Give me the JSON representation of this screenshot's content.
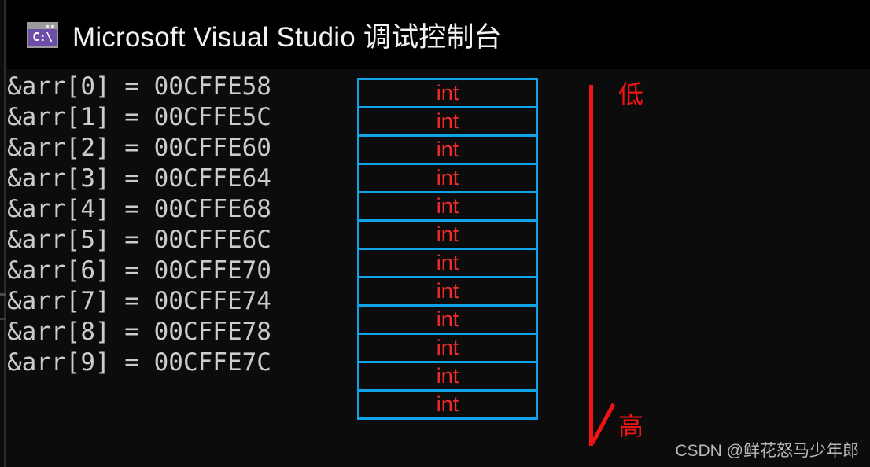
{
  "window": {
    "title": "Microsoft Visual Studio 调试控制台",
    "icon_name": "console-icon",
    "icon_text": "C:\\",
    "titlebar_bg": "#000000",
    "console_bg": "#0c0c0c"
  },
  "console": {
    "text_color": "#cccccc",
    "address_rows": [
      {
        "expr": "&arr[0]",
        "eq": "=",
        "address": "00CFFE58",
        "line": "&arr[0] = 00CFFE58"
      },
      {
        "expr": "&arr[1]",
        "eq": "=",
        "address": "00CFFE5C",
        "line": "&arr[1] = 00CFFE5C"
      },
      {
        "expr": "&arr[2]",
        "eq": "=",
        "address": "00CFFE60",
        "line": "&arr[2] = 00CFFE60"
      },
      {
        "expr": "&arr[3]",
        "eq": "=",
        "address": "00CFFE64",
        "line": "&arr[3] = 00CFFE64"
      },
      {
        "expr": "&arr[4]",
        "eq": "=",
        "address": "00CFFE68",
        "line": "&arr[4] = 00CFFE68"
      },
      {
        "expr": "&arr[5]",
        "eq": "=",
        "address": "00CFFE6C",
        "line": "&arr[5] = 00CFFE6C"
      },
      {
        "expr": "&arr[6]",
        "eq": "=",
        "address": "00CFFE70",
        "line": "&arr[6] = 00CFFE70"
      },
      {
        "expr": "&arr[7]",
        "eq": "=",
        "address": "00CFFE74",
        "line": "&arr[7] = 00CFFE74"
      },
      {
        "expr": "&arr[8]",
        "eq": "=",
        "address": "00CFFE78",
        "line": "&arr[8] = 00CFFE78"
      },
      {
        "expr": "&arr[9]",
        "eq": "=",
        "address": "00CFFE7C",
        "line": "&arr[9] = 00CFFE7C"
      }
    ]
  },
  "memory_diagram": {
    "cell_border_color": "#0fa3e8",
    "cell_label_color": "#f22b2b",
    "cells": [
      {
        "label": "int"
      },
      {
        "label": "int"
      },
      {
        "label": "int"
      },
      {
        "label": "int"
      },
      {
        "label": "int"
      },
      {
        "label": "int"
      },
      {
        "label": "int"
      },
      {
        "label": "int"
      },
      {
        "label": "int"
      },
      {
        "label": "int"
      },
      {
        "label": "int"
      },
      {
        "label": "int"
      }
    ]
  },
  "annotation": {
    "arrow_color": "#f21414",
    "top_label": "低",
    "bottom_label": "高"
  },
  "watermark": {
    "text": "CSDN @鲜花怒马少年郎",
    "color": "#b9b9b9"
  }
}
